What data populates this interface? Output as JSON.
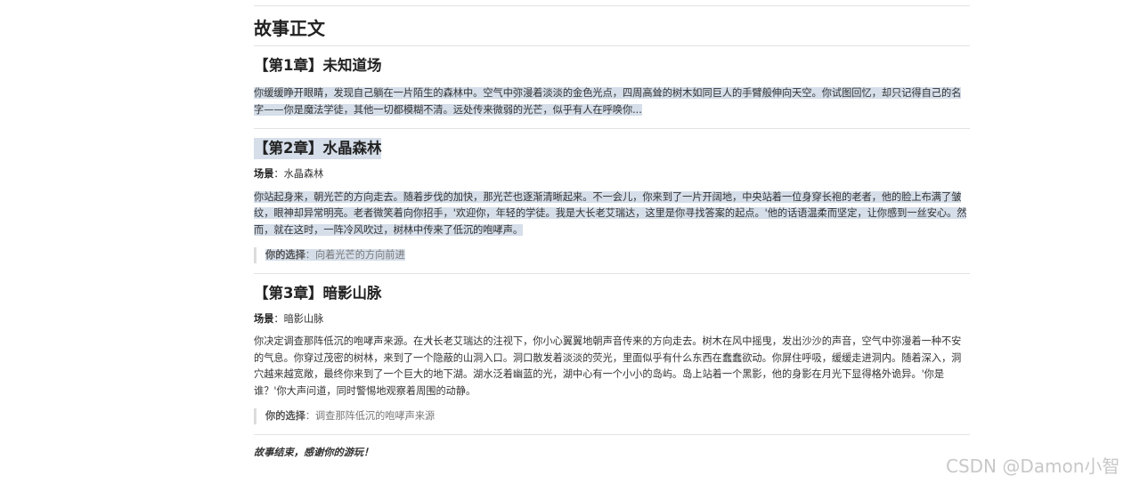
{
  "document": {
    "section_title": "故事正文",
    "chapters": [
      {
        "title": "【第1章】未知道场",
        "paragraph": "你缓缓睁开眼睛，发现自己躺在一片陌生的森林中。空气中弥漫着淡淡的金色光点，四周高耸的树木如同巨人的手臂般伸向天空。你试图回忆，却只记得自己的名字——你是魔法学徒，其他一切都模糊不清。远处传来微弱的光芒，似乎有人在呼唤你..."
      },
      {
        "title": "【第2章】水晶森林",
        "scene_label": "场景",
        "scene_value": "：水晶森林",
        "paragraph": "你站起身来，朝光芒的方向走去。随着步伐的加快，那光芒也逐渐清晰起来。不一会儿，你来到了一片开阔地，中央站着一位身穿长袍的老者，他的脸上布满了皱纹，眼神却异常明亮。老者微笑着向你招手，'欢迎你，年轻的学徒。我是大长老艾瑞达，这里是你寻找答案的起点。'他的话语温柔而坚定，让你感到一丝安心。然而，就在这时，一阵冷风吹过，树林中传来了低沉的咆哮声。",
        "choice_label": "你的选择",
        "choice_value": "：向着光芒的方向前进"
      },
      {
        "title": "【第3章】暗影山脉",
        "scene_label": "场景",
        "scene_value": "：暗影山脉",
        "paragraph": "你决定调查那阵低沉的咆哮声来源。在大长老艾瑞达的注视下，你小心翼翼地朝声音传来的方向走去。树木在风中摇曳，发出沙沙的声音，空气中弥漫着一种不安的气息。你穿过茂密的树林，来到了一个隐蔽的山洞入口。洞口散发着淡淡的荧光，里面似乎有什么东西在蠢蠢欲动。你屏住呼吸，缓缓走进洞内。随着深入，洞穴越来越宽敞，最终你来到了一个巨大的地下湖。湖水泛着幽蓝的光，湖中心有一个小小的岛屿。岛上站着一个黑影，他的身影在月光下显得格外诡异。'你是谁？'你大声问道，同时警惕地观察着周围的动静。",
        "choice_label": "你的选择",
        "choice_value": "：调查那阵低沉的咆哮声来源"
      }
    ],
    "ending": "故事结束，感谢你的游玩！"
  },
  "watermark": "CSDN @Damon小智",
  "colors": {
    "highlight": "#d5dee9",
    "divider": "#e3e3e3",
    "text": "#333333"
  }
}
